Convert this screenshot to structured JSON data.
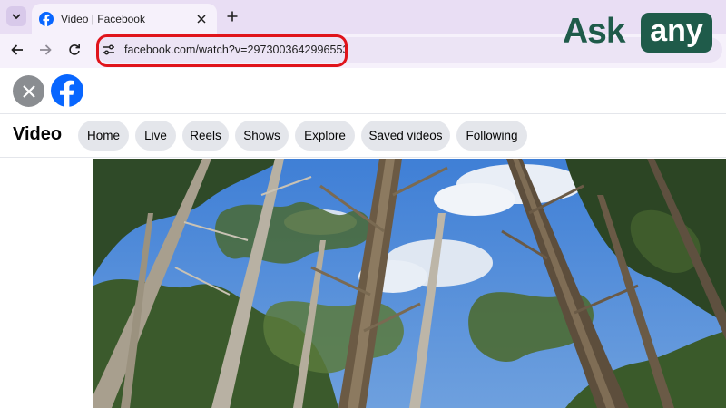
{
  "browser": {
    "tab": {
      "title": "Video | Facebook",
      "favicon": "facebook-icon"
    },
    "address_bar": {
      "url": "facebook.com/watch?v=2973003642996553"
    },
    "icons": [
      "tab-list-chevron-icon",
      "close-icon",
      "plus-icon",
      "back-arrow-icon",
      "forward-arrow-icon",
      "reload-icon",
      "site-info-tune-icon"
    ]
  },
  "watermark": {
    "left_text": "Ask",
    "boxed_text": "any"
  },
  "page": {
    "title": "Video",
    "nav": [
      {
        "label": "Home"
      },
      {
        "label": "Live"
      },
      {
        "label": "Reels"
      },
      {
        "label": "Shows"
      },
      {
        "label": "Explore"
      },
      {
        "label": "Saved videos"
      },
      {
        "label": "Following"
      }
    ],
    "video": {
      "subject": "forest-canopy-sky-image"
    }
  },
  "colors": {
    "tabstrip_bg": "#e9def4",
    "highlight": "#e0141b",
    "facebook_blue": "#0866ff",
    "brand_green": "#1f5b4a",
    "pill_bg": "#e4e6eb"
  }
}
